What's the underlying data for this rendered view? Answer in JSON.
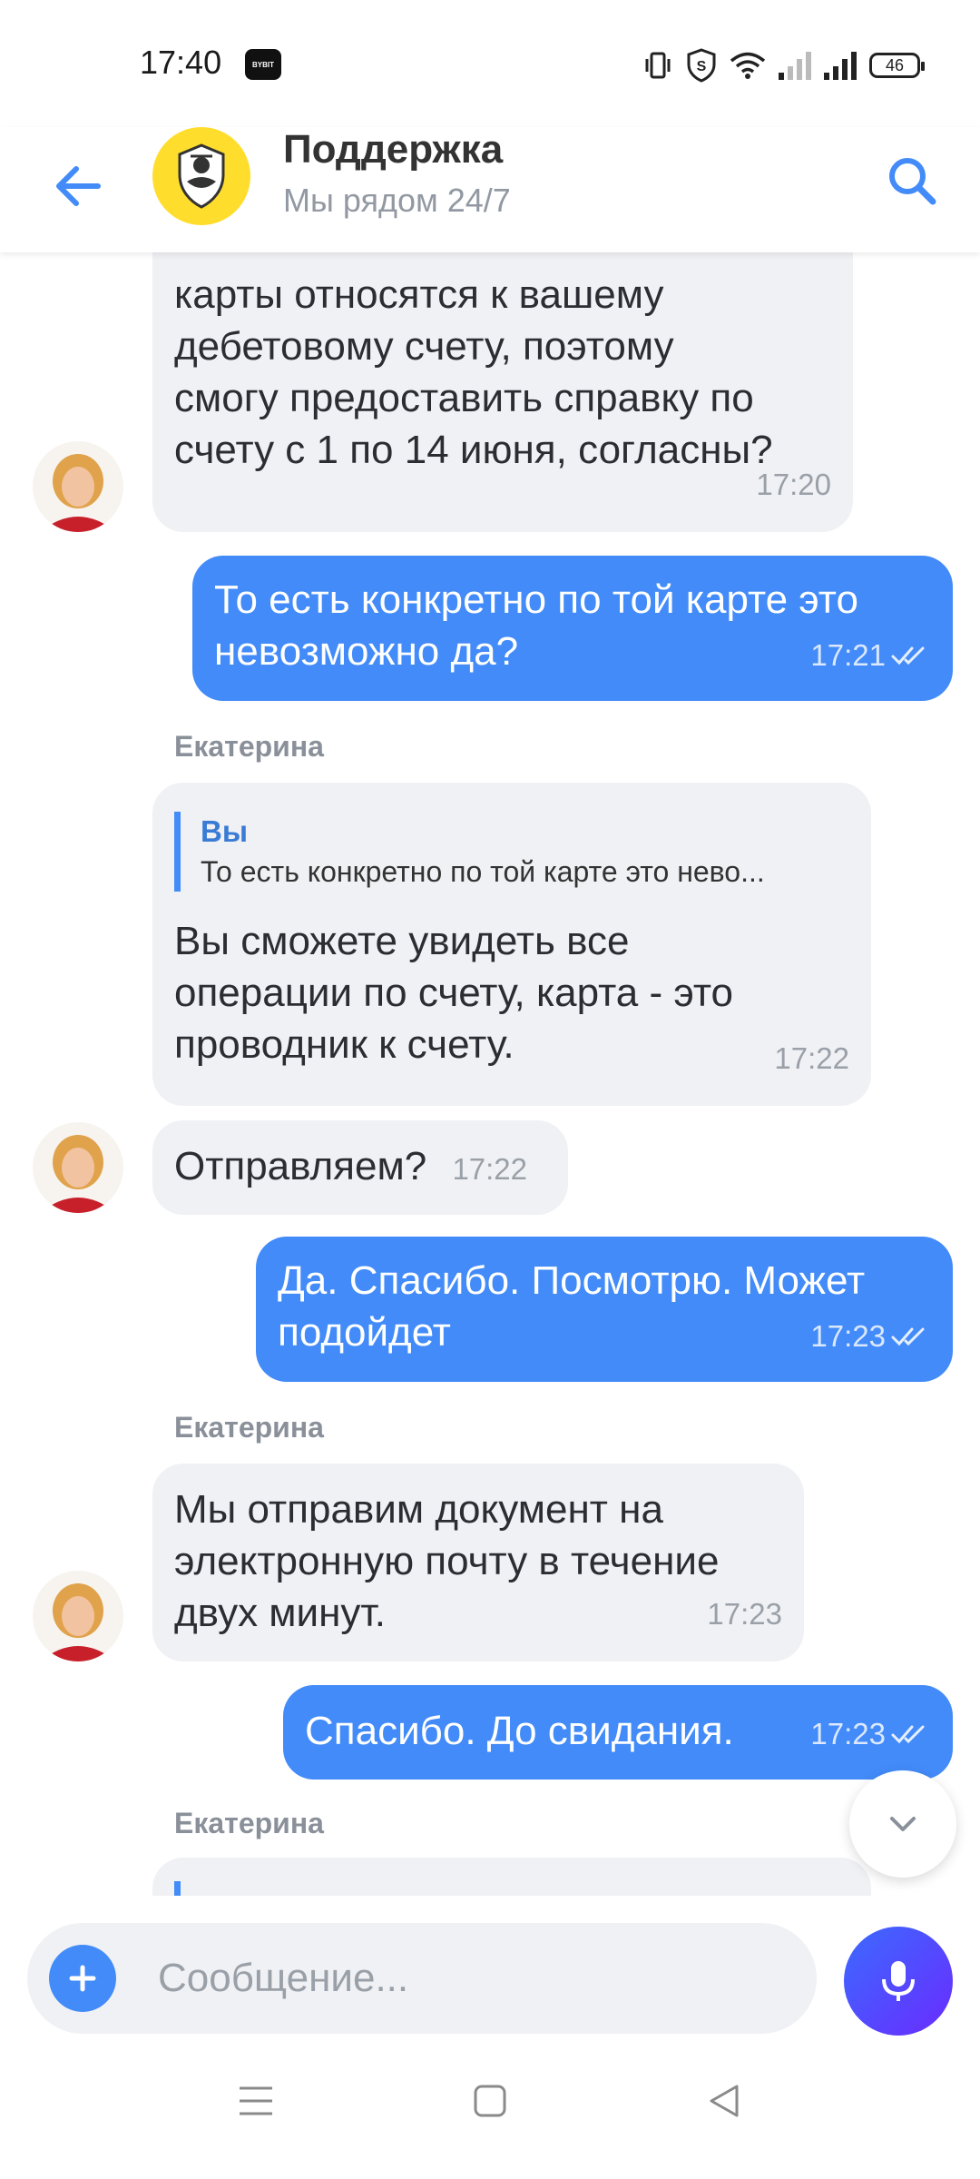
{
  "status_bar": {
    "time": "17:40",
    "app_badge": "BYBIT",
    "battery": "46"
  },
  "header": {
    "title": "Поддержка",
    "subtitle": "Мы рядом 24/7"
  },
  "messages": {
    "m1": {
      "lines": [
        "карты относятся к вашему",
        "дебетовому счету, поэтому",
        "смогу предоставить справку по",
        "счету с 1 по 14 июня, согласны?"
      ],
      "time": "17:20"
    },
    "m2": {
      "lines": [
        "То есть конкретно по той карте это",
        "невозможно да?"
      ],
      "time": "17:21"
    },
    "sender1": "Екатерина",
    "m3": {
      "quote_name": "Вы",
      "quote_text": "То есть конкретно по той карте это нево...",
      "lines": [
        "Вы сможете увидеть все",
        "операции по счету, карта - это",
        "проводник к счету."
      ],
      "time": "17:22"
    },
    "m4": {
      "text": "Отправляем?",
      "time": "17:22"
    },
    "m5": {
      "lines": [
        "Да. Спасибо. Посмотрю. Может",
        "подойдет"
      ],
      "time": "17:23"
    },
    "sender2": "Екатерина",
    "m6": {
      "lines": [
        "Мы отправим документ на",
        "электронную почту в течение",
        "двух минут."
      ],
      "time": "17:23"
    },
    "m7": {
      "text": "Спасибо. До свидания.",
      "time": "17:23"
    },
    "sender3": "Екатерина"
  },
  "composer": {
    "placeholder": "Сообщение..."
  },
  "colors": {
    "accent": "#428bf9",
    "incoming": "#f0f1f4",
    "logo_yellow": "#ffdd2d"
  }
}
